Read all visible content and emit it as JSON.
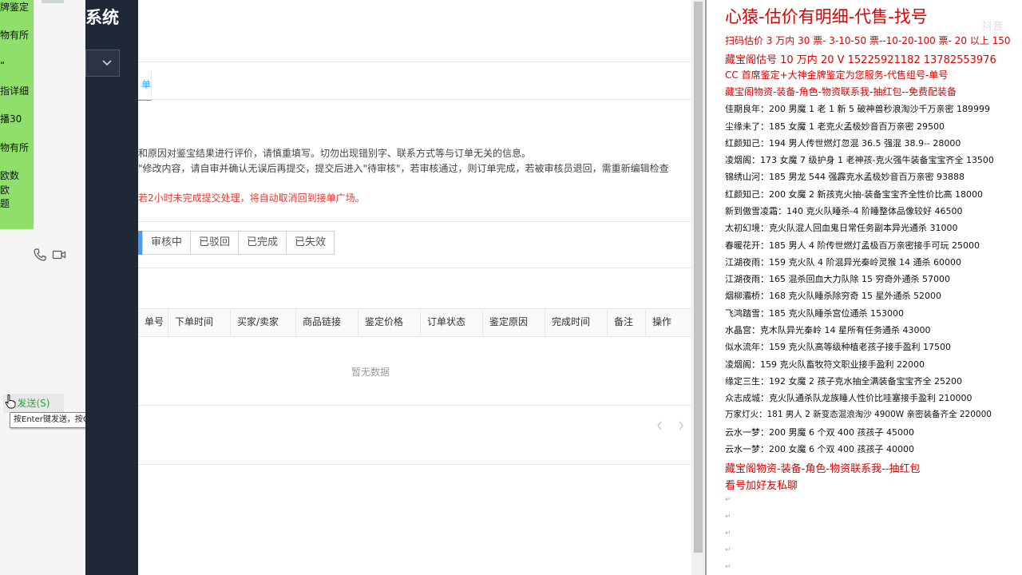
{
  "chat": {
    "lines": [
      "牌鉴定",
      "物有所",
      "“",
      "指详细",
      "播30",
      "物有所",
      "欧数",
      "欧",
      "题"
    ],
    "send_label": "发送(S)",
    "send_tooltip": "按Enter键发送，按Ctrl+Enter键换行"
  },
  "admin": {
    "system_title": "系统",
    "tab_partial": "单",
    "notices": [
      "和原因对鉴宝结果进行评价，请慎重填写。切勿出现错别字、联系方式等与订单无关的信息。",
      "\"修改内容，请自审并确认无误后再提交，提交后进入\"待审核\"，若审核通过，则订单完成，若被审核员退回，需重新编辑检查",
      "若2小时未完成提交处理，将自动取消回到接单广场。"
    ],
    "status_tabs": [
      "审核中",
      "已驳回",
      "已完成",
      "已失效"
    ],
    "table_headers": [
      "单号",
      "下单时间",
      "买家/卖家",
      "商品链接",
      "鉴定价格",
      "订单状态",
      "鉴定原因",
      "完成时间",
      "备注",
      "操作"
    ],
    "empty_text": "暂无数据"
  },
  "document": {
    "title": "心猿-估价有明细-代售-找号",
    "watermark": "抖音",
    "red_lines": [
      "扫码估价 3 万内 30 票- 3-10-50 票--10-20-100 票- 20 以上 150",
      "藏宝阁估号 10 万内 20 V 15225921182   13782553976",
      "CC 首席鉴定+大神金牌鉴定为您服务-代售组号-单号",
      "藏宝阁物资-装备-角色-物资联系我-抽红包--免费配装备"
    ],
    "listings": [
      "佳期良年：200 男魔 1 老 1 新 5 破神兽秒浪淘沙千万亲密 189999",
      "尘缘未了：185 女魔 1 老克火孟极妙音百万亲密 29500",
      "红颜知己：194 男人传世燃灯忽混 36.5 强混 38.9-- 28000",
      "凌烟阁：173 女魔 7 级护身 1 老神孩-克火强牛装备宝宝齐全 13500",
      "锦绣山河：185 男龙 544 强霹克水孟极妙音百万亲密 93888",
      "红颜知己：200 女魔 2 新孩克火抽-装备宝宝齐全性价比高 18000",
      "新到傲雪凌霜：140 克火队睡杀-4 阶睡整体品像较好 46500",
      "太初幻境：克火队混人回血鬼日常任务副本异光通杀 31000",
      "春暖花开：185 男人 4 阶传世燃灯孟极百万亲密接手可玩 25000",
      "江湖夜雨：159 克火队 4 阶混异光秦岭灵猴 14 通杀 60000",
      "江湖夜雨：165 混杀回血大力队除 15 穷奇外通杀 57000",
      "烟柳灞桥：168 克火队睡杀除穷奇 15 星外通杀 52000",
      "飞鸿踏雪：185 克火队睡杀宫位通杀 153000",
      "水晶宫：克木队异光秦岭 14 星所有任务通杀 43000",
      "似水流年：159 克火队高等级种植老孩子接手盈利 17500",
      "凌烟阁：159 克火队畜牧符文职业接手盈利 22000",
      "缘定三生：192 女魔 2 孩子克水抽全满装备宝宝齐全 25200",
      "众志成城：克火队通杀队龙族睡人性价比哇塞接手盈利 210000",
      "万家灯火：181 男人 2 新变态混浪淘沙 4900W 亲密装备齐全 220000",
      "云水一梦：200 男魔 6 个双 400 孩孩子 45000",
      "云水一梦：200 女魔 6 个双 400 孩孩子 40000"
    ],
    "footer_red": [
      "藏宝阁物资-装备-角色-物资联系我--抽红包",
      "看号加好友私聊"
    ],
    "paragraph_mark": "↵"
  },
  "colors": {
    "accent": "#409eff",
    "doc_red": "#e00000",
    "chat_green": "#8fe06a",
    "sidebar": "#1f2836"
  }
}
